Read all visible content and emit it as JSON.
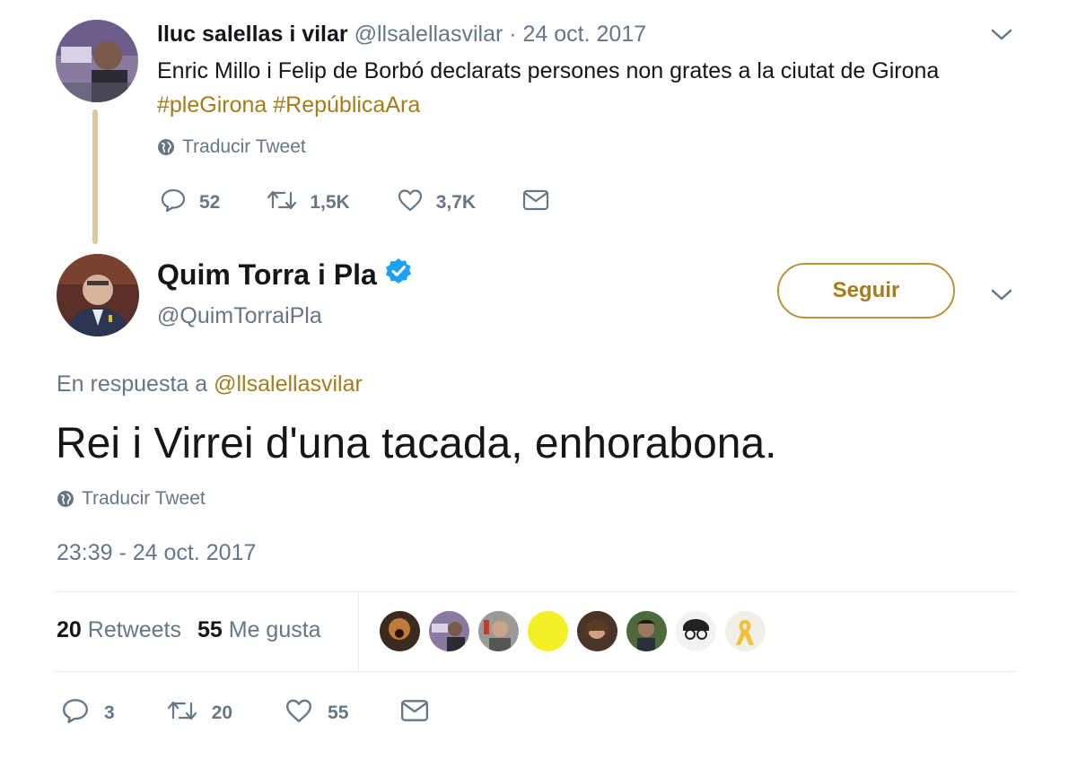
{
  "parent_tweet": {
    "name": "lluc salellas i vilar",
    "handle": "@llsalellasvilar",
    "date": "· 24 oct. 2017",
    "text": "Enric Millo i Felip de Borbó declarats persones non grates a la ciutat de Girona",
    "hashtags": "#pleGirona #RepúblicaAra",
    "translate": "Traducir Tweet",
    "replies": "52",
    "retweets": "1,5K",
    "likes": "3,7K"
  },
  "main_tweet": {
    "name": "Quim Torra i Pla",
    "handle": "@QuimTorraiPla",
    "follow_label": "Seguir",
    "reply_prefix": "En respuesta a",
    "reply_handle": "@llsalellasvilar",
    "text": "Rei i Virrei d'una tacada, enhorabona.",
    "translate": "Traducir Tweet",
    "timestamp": "23:39 - 24 oct. 2017",
    "retweet_count": "20",
    "retweet_label": "Retweets",
    "like_count": "55",
    "like_label": "Me gusta",
    "replies": "3",
    "retweets": "20",
    "likes": "55"
  },
  "colors": {
    "accent": "#a57c1b",
    "muted": "#657786",
    "verified": "#1da1f2",
    "thread_line": "#d8c9a4"
  },
  "icons": [
    "chevron-down-icon",
    "globe-icon",
    "reply-icon",
    "retweet-icon",
    "like-icon",
    "dm-icon",
    "verified-badge-icon"
  ]
}
